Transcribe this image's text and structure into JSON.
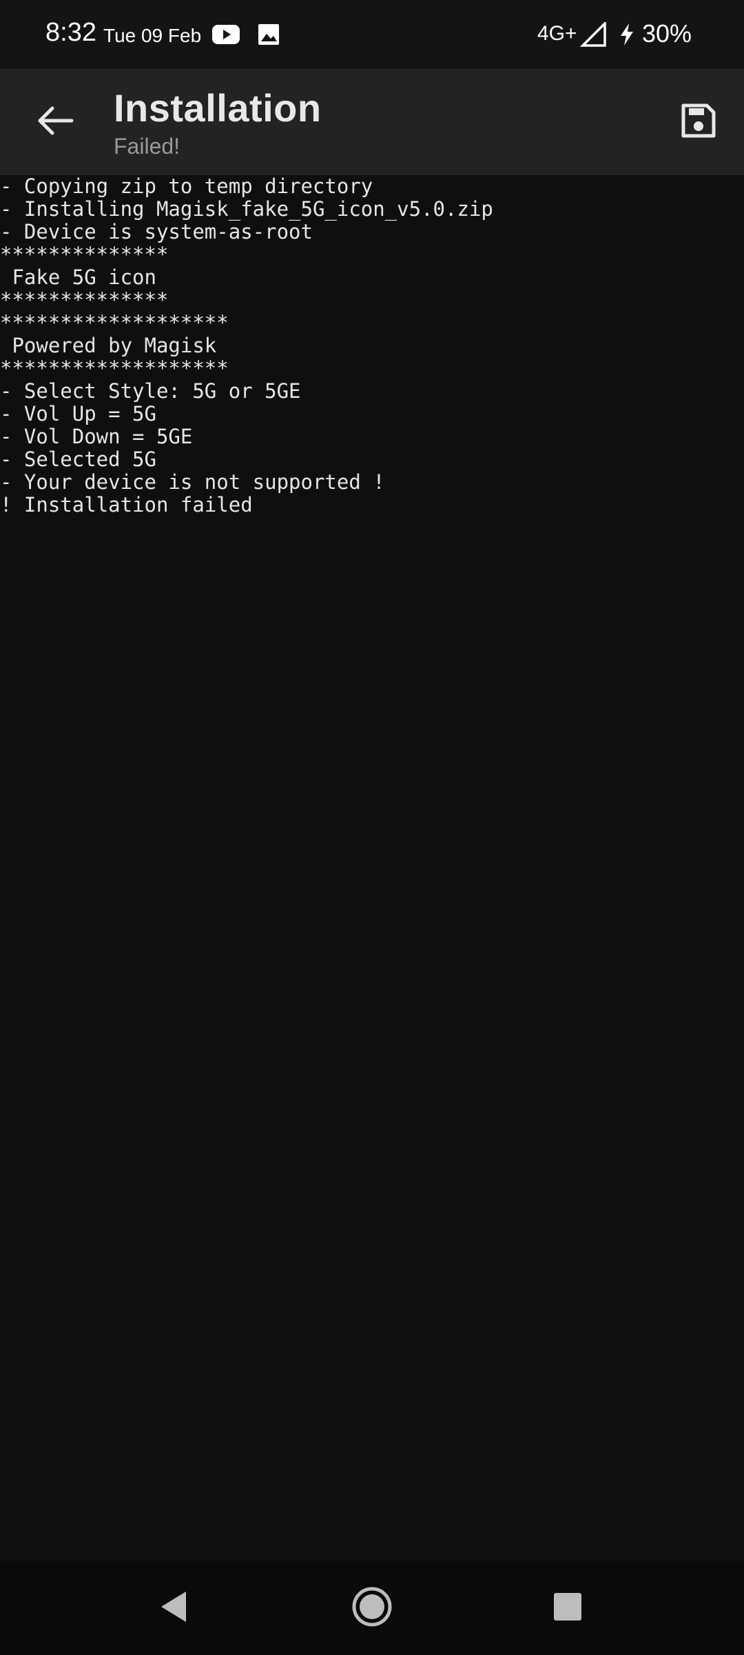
{
  "status_bar": {
    "time": "8:32",
    "date": "Tue 09 Feb",
    "network": "4G+",
    "battery": "30%",
    "icons": [
      "youtube-icon",
      "image-icon",
      "signal-icon",
      "charging-icon"
    ]
  },
  "app_bar": {
    "title": "Installation",
    "subtitle": "Failed!",
    "back_icon": "arrow-back-icon",
    "save_icon": "save-icon"
  },
  "console": {
    "lines": [
      "- Copying zip to temp directory",
      "- Installing Magisk_fake_5G_icon_v5.0.zip",
      "- Device is system-as-root",
      "**************",
      " Fake 5G icon",
      "**************",
      "*******************",
      " Powered by Magisk",
      "*******************",
      "- Select Style: 5G or 5GE",
      "- Vol Up = 5G",
      "- Vol Down = 5GE",
      "- Selected 5G",
      "- Your device is not supported !",
      "! Installation failed"
    ]
  },
  "nav_bar": {
    "icons": [
      "nav-back-icon",
      "home-icon",
      "recents-icon"
    ]
  },
  "colors": {
    "background": "#0f0f0f",
    "status_bar": "#141414",
    "app_bar": "#232323",
    "nav_bar": "#0a0a0a",
    "text": "#e6e6e6",
    "subtitle": "#9a9a9a"
  }
}
